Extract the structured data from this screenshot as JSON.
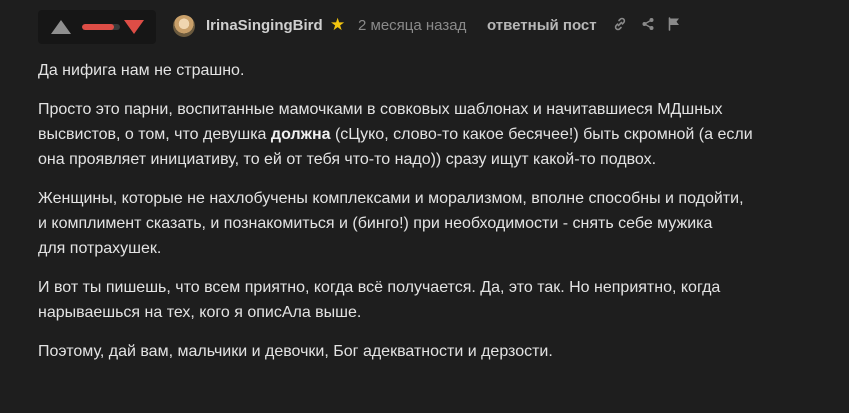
{
  "vote": {
    "up_color": "#8f8f8f",
    "down_color": "#dd4d46",
    "rating_fill": 0.85
  },
  "author": {
    "name": "IrinaSingingBird",
    "badge_icon": "star-icon",
    "badge_symbol": "★"
  },
  "meta": {
    "time": "2 месяца назад",
    "reply_label": "ответный пост"
  },
  "actions": {
    "link_icon": "link-icon",
    "share_icon": "share-icon",
    "flag_icon": "flag-icon"
  },
  "post": {
    "p1": "Да нифига нам не страшно.",
    "p2_l1": "Просто это парни, воспитанные мамочками в совковых шаблонах и начитавшиеся МДшных",
    "p2_l2_a": "высвистов, о том, что девушка ",
    "p2_l2_bold": "должна",
    "p2_l2_b": " (сЦуко, слово-то какое бесячее!) быть скромной (а если",
    "p2_l3": "она проявляет инициативу, то ей от тебя что-то надо)) сразу ищут какой-то подвох.",
    "p3_l1": "Женщины, которые не нахлобучены комплексами и морализмом, вполне способны и подойти,",
    "p3_l2": "и комплимент сказать, и познакомиться и (бинго!) при необходимости - снять себе мужика",
    "p3_l3": "для потрахушек.",
    "p4_l1": "И вот ты пишешь, что всем приятно, когда всё получается. Да, это так. Но неприятно, когда",
    "p4_l2": "нарываешься на тех, кого я описАла выше.",
    "p5": "Поэтому, дай вам, мальчики и девочки, Бог адекватности и дерзости."
  }
}
